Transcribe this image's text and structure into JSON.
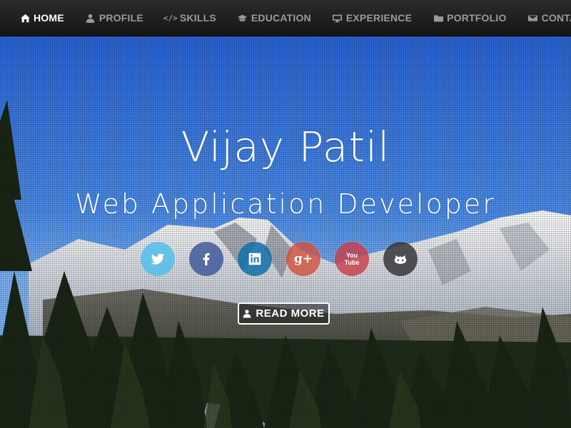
{
  "nav": {
    "items": [
      {
        "label": "HOME",
        "icon": "home-icon",
        "active": true
      },
      {
        "label": "PROFILE",
        "icon": "user-icon",
        "active": false
      },
      {
        "label": "SKILLS",
        "icon": "code-icon",
        "active": false
      },
      {
        "label": "EDUCATION",
        "icon": "graduation-cap-icon",
        "active": false
      },
      {
        "label": "EXPERIENCE",
        "icon": "desktop-icon",
        "active": false
      },
      {
        "label": "PORTFOLIO",
        "icon": "folder-icon",
        "active": false
      },
      {
        "label": "CONTACT",
        "icon": "envelope-icon",
        "active": false
      }
    ],
    "code_glyph": "</>"
  },
  "hero": {
    "name": "Vijay Patil",
    "title": "Web Application Developer",
    "social": [
      {
        "name": "twitter",
        "icon": "twitter-icon",
        "color": "#52beeb"
      },
      {
        "name": "facebook",
        "icon": "facebook-icon",
        "color": "#415a9b"
      },
      {
        "name": "linkedin",
        "icon": "linkedin-icon",
        "color": "#126eaa"
      },
      {
        "name": "google-plus",
        "icon": "google-plus-icon",
        "color": "#d2503c"
      },
      {
        "name": "youtube",
        "icon": "youtube-icon",
        "color": "#c83c46"
      },
      {
        "name": "github",
        "icon": "github-icon",
        "color": "#37373c"
      }
    ],
    "gplus_text": "g+",
    "youtube_text": "You Tube",
    "button": {
      "label": "READ MORE",
      "icon": "user-icon"
    }
  },
  "colors": {
    "navbar": "#1c1c1c",
    "nav_active": "#ffffff",
    "nav_inactive": "#9a9a9a",
    "sky": "#2f6fd9"
  }
}
